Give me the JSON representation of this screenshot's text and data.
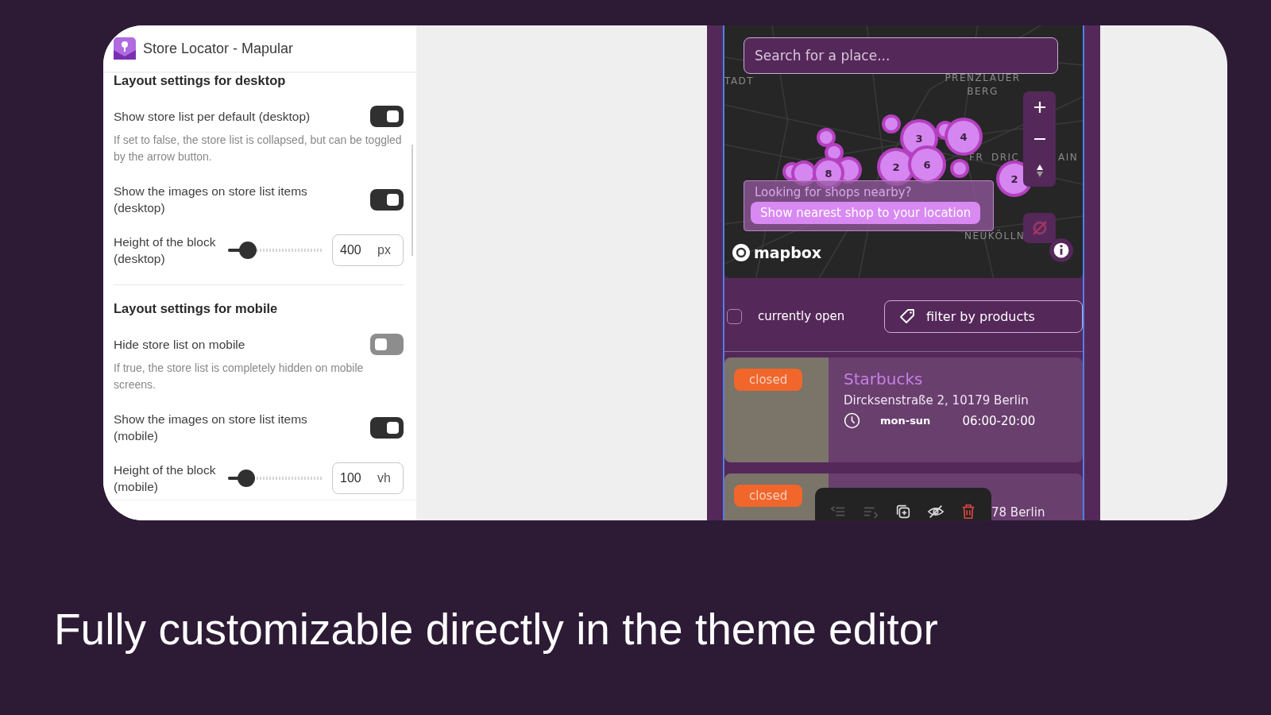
{
  "editor_panel": {
    "app_title": "Store Locator - Mapular",
    "sections": [
      {
        "title": "Layout settings for desktop",
        "settings": [
          {
            "kind": "toggle",
            "label": "Show store list per default (desktop)",
            "on": true,
            "help": "If set to false, the store list is collapsed, but can be toggled by the arrow button."
          },
          {
            "kind": "toggle",
            "label": "Show the images on store list items (desktop)",
            "on": true
          },
          {
            "kind": "slider",
            "label": "Height of the block (desktop)",
            "level": 0.22,
            "value": "400",
            "unit": "px"
          }
        ]
      },
      {
        "title": "Layout settings for mobile",
        "settings": [
          {
            "kind": "toggle",
            "label": "Hide store list on mobile",
            "on": false,
            "help": "If true, the store list is completely hidden on mobile screens."
          },
          {
            "kind": "toggle",
            "label": "Show the images on store list items (mobile)",
            "on": true
          },
          {
            "kind": "slider",
            "label": "Height of the block (mobile)",
            "level": 0.2,
            "value": "100",
            "unit": "vh"
          }
        ]
      }
    ]
  },
  "preview": {
    "search": {
      "placeholder": "Search for a place..."
    },
    "map": {
      "place_labels": [
        "TADT",
        "PRENZLAUER BERG",
        "FR",
        "DRIC",
        "AIN",
        "NEUKÖLLN"
      ],
      "clusters": [
        "8",
        "3",
        "4",
        "2",
        "6",
        "2"
      ],
      "nearby_prompt": {
        "text": "Looking for shops nearby?",
        "button": "Show nearest shop to your location"
      },
      "attribution": "mapbox"
    },
    "filters": {
      "open_label": "currently open",
      "open_checked": false,
      "products_button": "filter by products"
    },
    "stores": [
      {
        "status": "closed",
        "name": "Starbucks",
        "address": "Dircksenstraße 2, 10179 Berlin",
        "days": "mon-sun",
        "hours": "06:00-20:00"
      },
      {
        "status": "closed",
        "address": "78 Berlin"
      }
    ]
  },
  "caption": "Fully customizable directly in the theme editor"
}
